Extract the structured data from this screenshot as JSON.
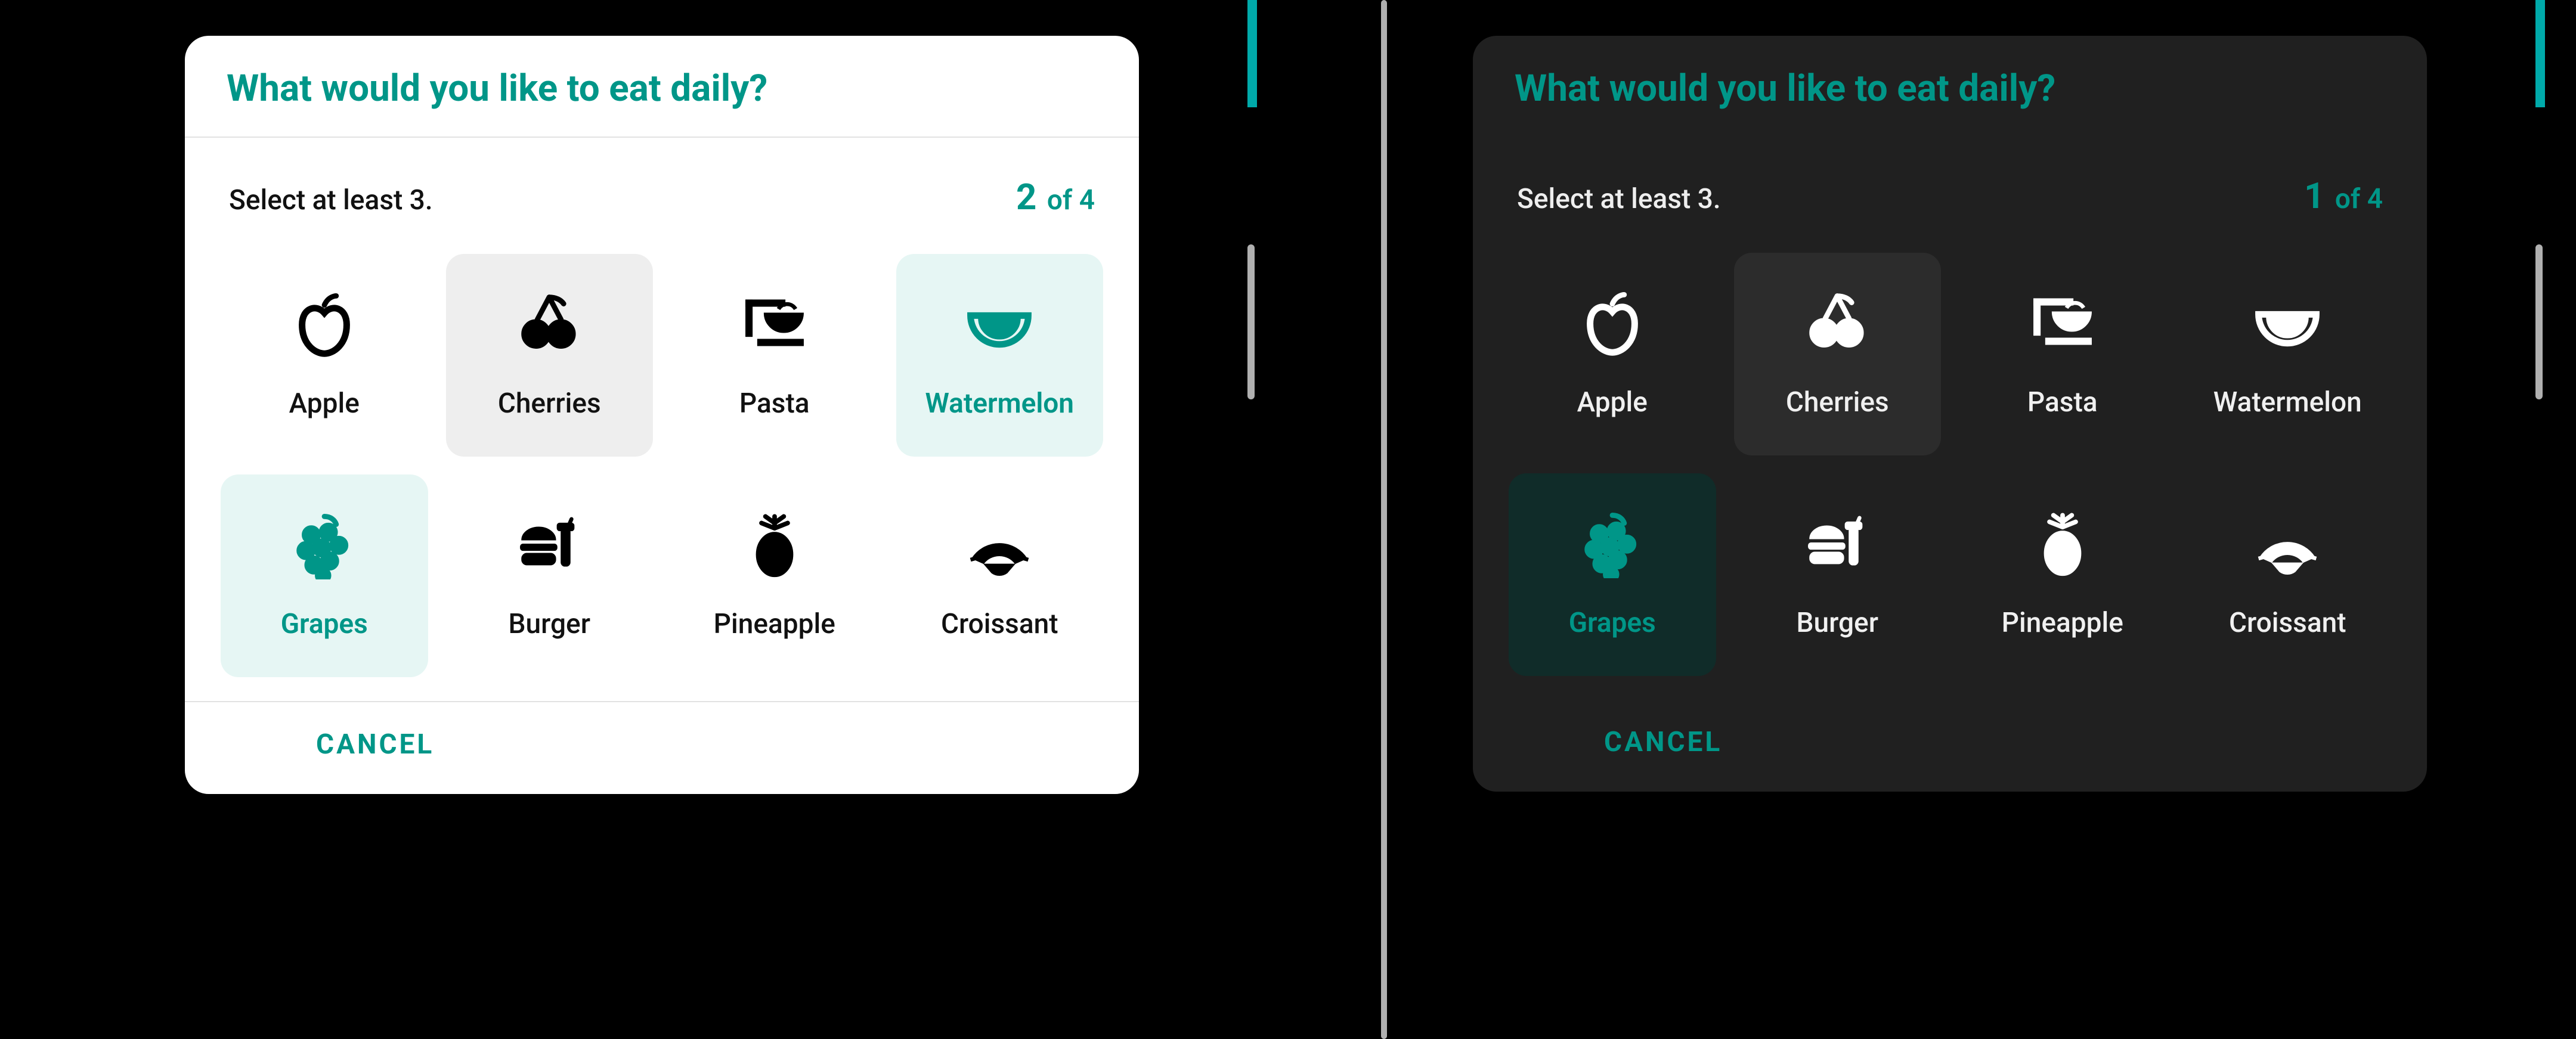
{
  "accent_color": "#009688",
  "title": "What would you like to eat daily?",
  "instruction": "Select at least 3.",
  "counter_total": "4",
  "counter_of": "of",
  "cancel_label": "CANCEL",
  "items": [
    {
      "id": "apple",
      "label": "Apple",
      "icon": "apple-icon"
    },
    {
      "id": "cherries",
      "label": "Cherries",
      "icon": "cherries-icon"
    },
    {
      "id": "pasta",
      "label": "Pasta",
      "icon": "pasta-icon"
    },
    {
      "id": "watermelon",
      "label": "Watermelon",
      "icon": "watermelon-icon"
    },
    {
      "id": "grapes",
      "label": "Grapes",
      "icon": "grapes-icon"
    },
    {
      "id": "burger",
      "label": "Burger",
      "icon": "burger-icon"
    },
    {
      "id": "pineapple",
      "label": "Pineapple",
      "icon": "pineapple-icon"
    },
    {
      "id": "croissant",
      "label": "Croissant",
      "icon": "croissant-icon"
    }
  ],
  "variants": [
    {
      "theme": "light",
      "selected_count": "2",
      "item_states": {
        "apple": "none",
        "cherries": "hover",
        "pasta": "none",
        "watermelon": "selected",
        "grapes": "selected",
        "burger": "none",
        "pineapple": "none",
        "croissant": "none"
      }
    },
    {
      "theme": "dark",
      "selected_count": "1",
      "item_states": {
        "apple": "none",
        "cherries": "hover",
        "pasta": "none",
        "watermelon": "none",
        "grapes": "selected",
        "burger": "none",
        "pineapple": "none",
        "croissant": "none"
      }
    }
  ]
}
